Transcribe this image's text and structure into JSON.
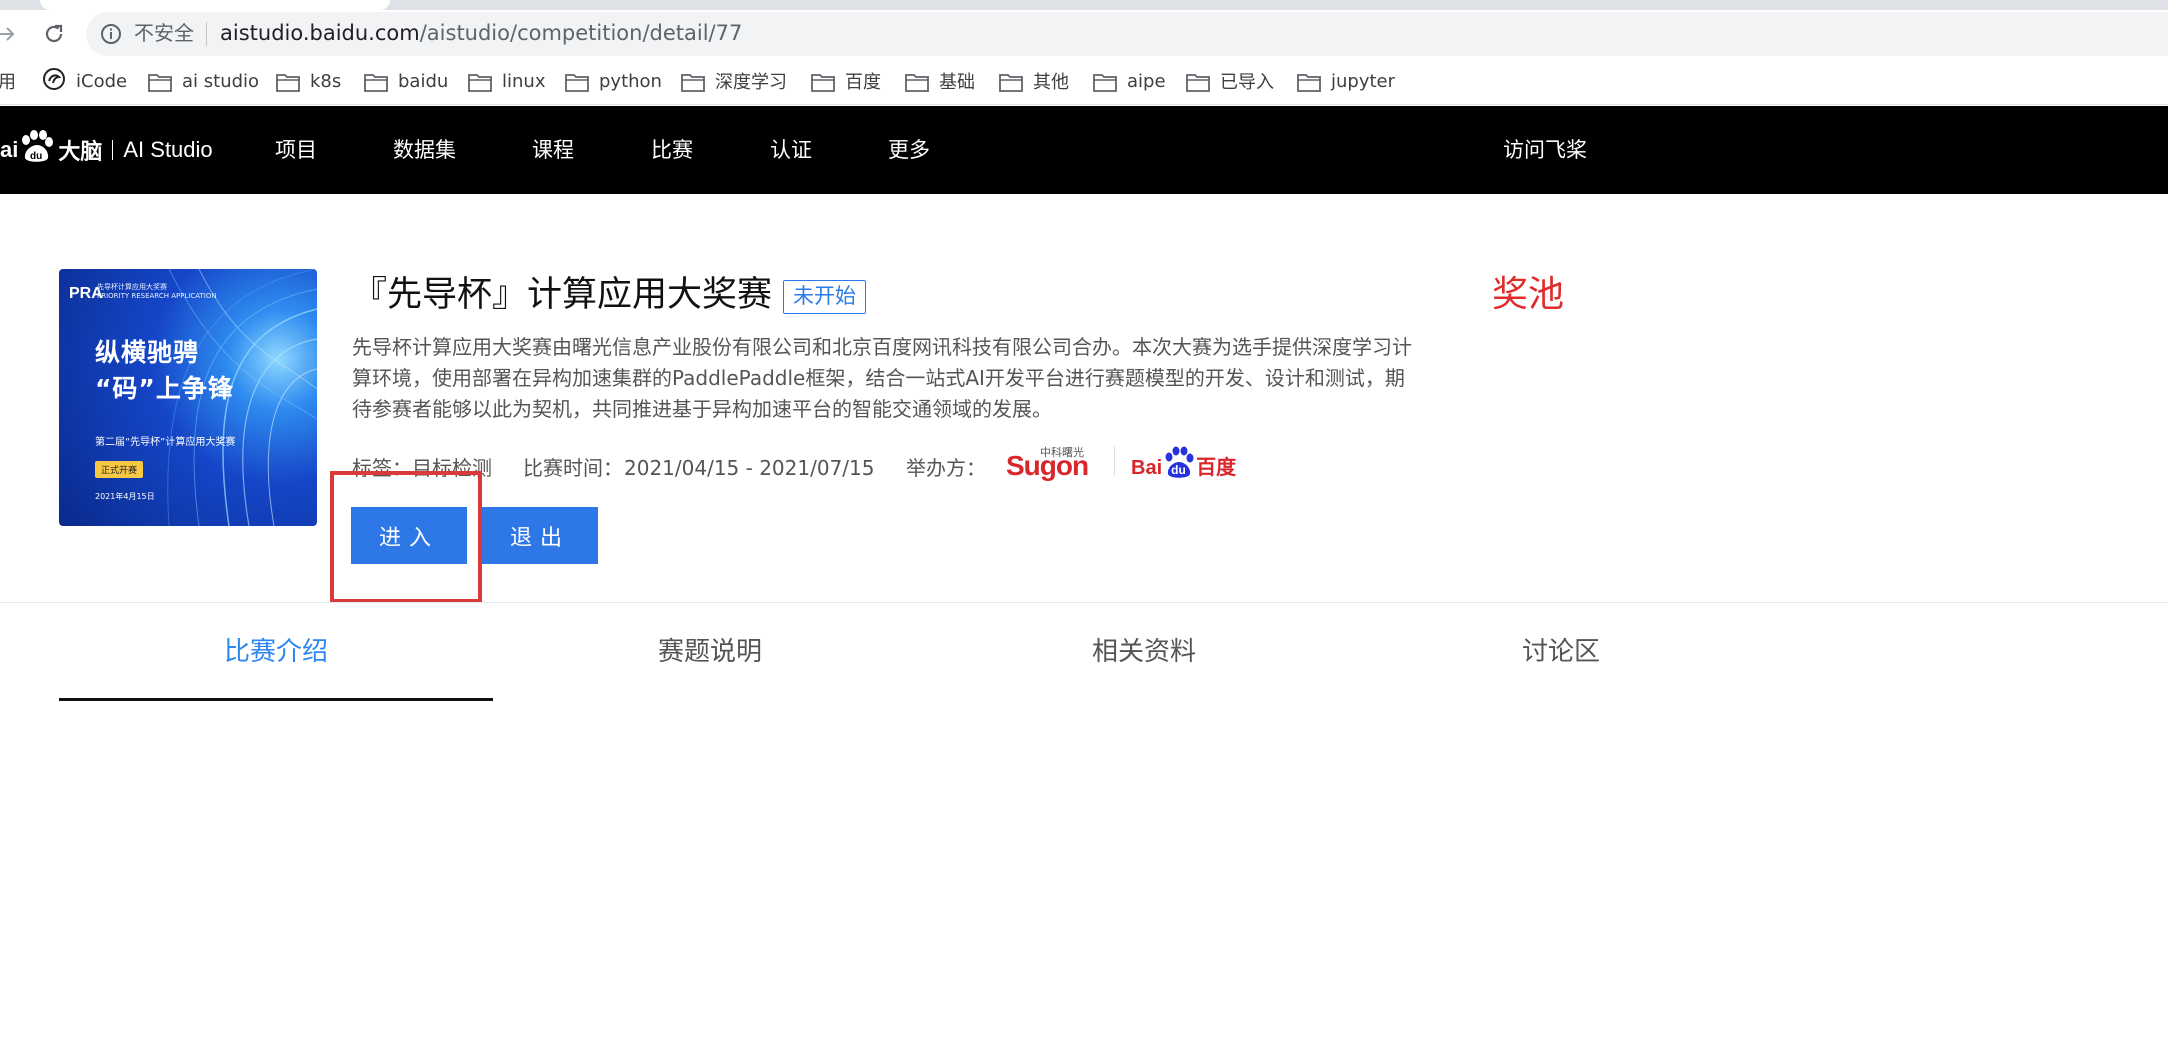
{
  "browser": {
    "security_label": "不安全",
    "url_host": "aistudio.baidu.com",
    "url_path": "/aistudio/competition/detail/77"
  },
  "bookmarks": [
    {
      "label": "用",
      "icon": "none"
    },
    {
      "label": "iCode",
      "icon": "icode-icon"
    },
    {
      "label": "ai studio",
      "icon": "folder-icon"
    },
    {
      "label": "k8s",
      "icon": "folder-icon"
    },
    {
      "label": "baidu",
      "icon": "folder-icon"
    },
    {
      "label": "linux",
      "icon": "folder-icon"
    },
    {
      "label": "python",
      "icon": "folder-icon"
    },
    {
      "label": "深度学习",
      "icon": "folder-icon"
    },
    {
      "label": "百度",
      "icon": "folder-icon"
    },
    {
      "label": "基础",
      "icon": "folder-icon"
    },
    {
      "label": "其他",
      "icon": "folder-icon"
    },
    {
      "label": "aipe",
      "icon": "folder-icon"
    },
    {
      "label": "已导入",
      "icon": "folder-icon"
    },
    {
      "label": "jupyter",
      "icon": "folder-icon"
    }
  ],
  "site": {
    "logo_text": "大脑",
    "brand": "AI Studio",
    "nav": [
      "项目",
      "数据集",
      "课程",
      "比赛",
      "认证",
      "更多"
    ],
    "visit_label": "访问飞桨"
  },
  "competition": {
    "cover": {
      "logo": "PRA",
      "subtitle_cn": "先导杯计算应用大奖赛",
      "subtitle_en": "PRIORITY RESEARCH APPLICATION",
      "line1": "纵横驰骋",
      "line2": "“码”上争锋",
      "line3": "第二届“先导杯”计算应用大奖赛",
      "badge": "正式开赛",
      "date": "2021年4月15日"
    },
    "title": "『先导杯』计算应用大奖赛",
    "status": "未开始",
    "prize_label": "奖池",
    "description": "先导杯计算应用大奖赛由曙光信息产业股份有限公司和北京百度网讯科技有限公司合办。本次大赛为选手提供深度学习计算环境，使用部署在异构加速集群的PaddlePaddle框架，结合一站式AI开发平台进行赛题模型的开发、设计和测试，期待参赛者能够以此为契机，共同推进基于异构加速平台的智能交通领域的发展。",
    "tags_label": "标签：",
    "tags_value": "目标检测",
    "time_label": "比赛时间：",
    "time_value": "2021/04/15 - 2021/07/15",
    "organizer_label": "举办方：",
    "organizers": {
      "sugon_cn": "中科曙光",
      "sugon_en": "Sugon",
      "baidu_en": "Bai",
      "baidu_du": "du",
      "baidu_cn": "百度"
    },
    "enter_button": "进入",
    "exit_button": "退出"
  },
  "tabs": [
    "比赛介绍",
    "赛题说明",
    "相关资料",
    "讨论区"
  ],
  "active_tab": 0,
  "colors": {
    "accent": "#2e77e6",
    "active_tab": "#2e86f0",
    "prize": "#e02b2b",
    "highlight_box": "#d93a3a"
  }
}
